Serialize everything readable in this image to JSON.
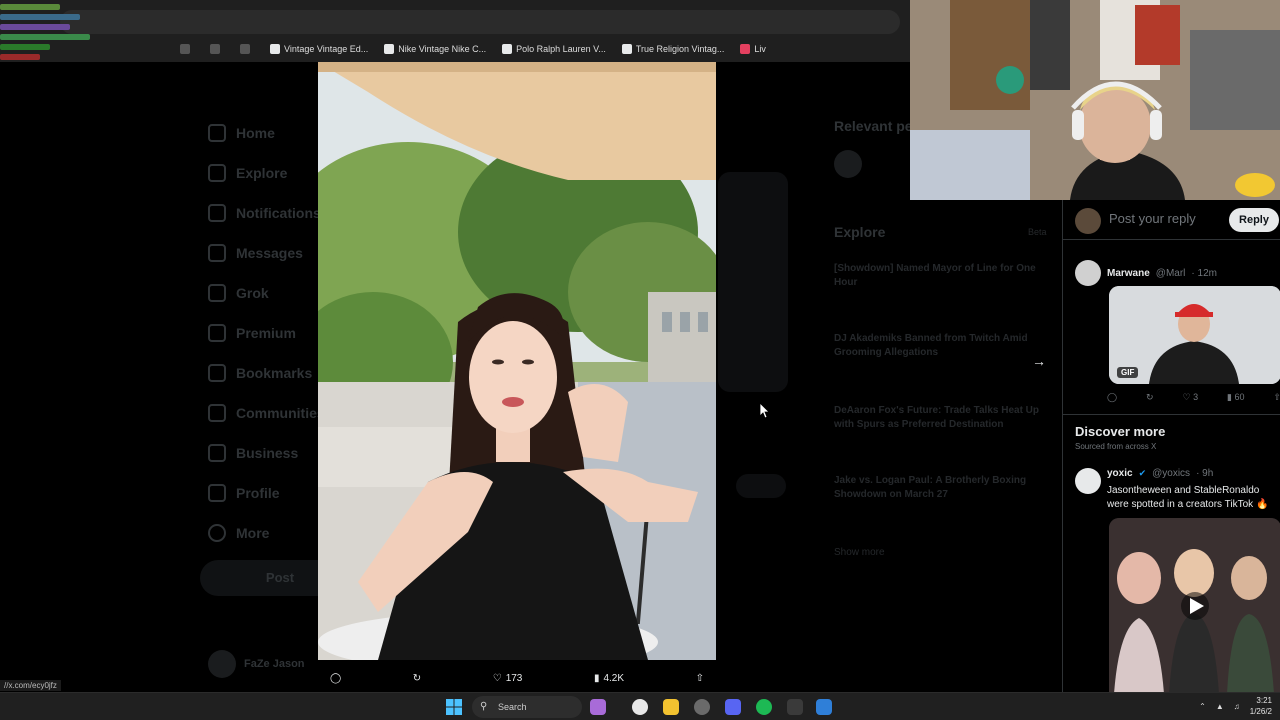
{
  "browser": {
    "address": "",
    "bookmarks": [
      {
        "label": "Vintage Vintage Ed...",
        "dim": false
      },
      {
        "label": "Nike Vintage Nike C...",
        "dim": false
      },
      {
        "label": "Polo Ralph Lauren V...",
        "dim": false
      },
      {
        "label": "True Religion Vintag...",
        "dim": false
      },
      {
        "label": "Liv",
        "dim": false
      }
    ]
  },
  "sidebar": {
    "items": [
      "Home",
      "Explore",
      "Notifications",
      "Messages",
      "Grok",
      "Premium",
      "Bookmarks",
      "Communities",
      "Business",
      "Profile",
      "More"
    ],
    "post_label": "Post",
    "profile_name": "FaZe Jason"
  },
  "photo_actions": {
    "likes": "173",
    "views": "4.2K"
  },
  "right_col": {
    "relevant_title": "Relevant people",
    "explore_title": "Explore",
    "explore_badge": "Beta",
    "stories": [
      "[Showdown] Named Mayor of Line for One Hour",
      "DJ Akademiks Banned from Twitch Amid Grooming Allegations",
      "DeAaron Fox's Future: Trade Talks Heat Up with Spurs as Preferred Destination",
      "Jake vs. Logan Paul: A Brotherly Boxing Showdown on March 27"
    ],
    "show_more": "Show more"
  },
  "reply_panel": {
    "placeholder": "Post your reply",
    "reply_button": "Reply",
    "post1": {
      "name": "Marwane",
      "handle": "@Marl",
      "time": "· 12m",
      "gif_label": "GIF",
      "likes": "3",
      "views": "60"
    },
    "discover_title": "Discover more",
    "discover_sub": "Sourced from across X",
    "post2": {
      "name": "yoxic",
      "handle": "@yoxics",
      "time": "· 9h",
      "text": "Jasontheween and StableRonaldo were spotted in a creators TikTok 🔥"
    }
  },
  "taskbar": {
    "search_label": "Search",
    "url_status": "//x.com/ecy0jfz",
    "time": "3:21",
    "date": "1/26/2"
  },
  "colors": {
    "background": "#000000",
    "text": "#e7e9ea",
    "muted": "#71767b",
    "border": "#2f3336",
    "accent": "#1d9bf0"
  }
}
